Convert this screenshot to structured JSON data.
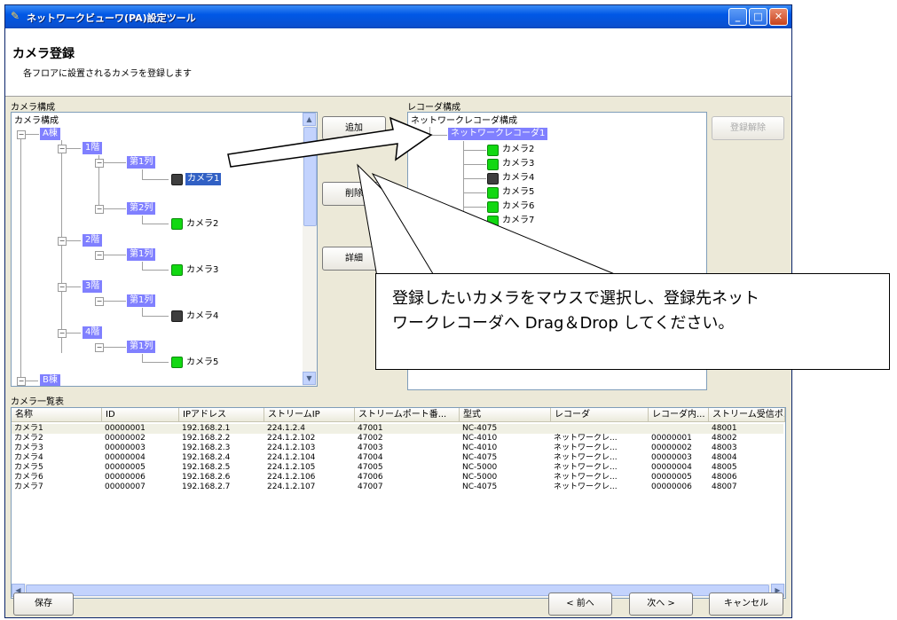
{
  "window": {
    "title": "ネットワークビューワ(PA)設定ツール"
  },
  "header": {
    "title": "カメラ登録",
    "subtitle": "各フロアに設置されるカメラを登録します"
  },
  "camera_tree": {
    "label": "カメラ構成",
    "root": "カメラ構成",
    "nodes": {
      "buildingA": "A棟",
      "floor1": "1階",
      "f1row1": "第1列",
      "cam1": "カメラ1",
      "f1row2": "第2列",
      "cam2": "カメラ2",
      "floor2": "2階",
      "f2row1": "第1列",
      "cam3": "カメラ3",
      "floor3": "3階",
      "f3row1": "第1列",
      "cam4": "カメラ4",
      "floor4": "4階",
      "f4row1": "第1列",
      "cam5": "カメラ5",
      "buildingB": "B棟"
    }
  },
  "recorder_tree": {
    "label": "レコーダ構成",
    "root": "ネットワークレコーダ構成",
    "recorder": "ネットワークレコーダ1",
    "cams": [
      "カメラ2",
      "カメラ3",
      "カメラ4",
      "カメラ5",
      "カメラ6",
      "カメラ7"
    ]
  },
  "buttons": {
    "add": "追加",
    "delete": "削除",
    "detail": "詳細",
    "unregister": "登録解除",
    "save": "保存",
    "prev": "< 前へ",
    "next": "次へ >",
    "cancel": "キャンセル"
  },
  "camera_list": {
    "label": "カメラ一覧表",
    "columns": [
      "名称",
      "ID",
      "IPアドレス",
      "ストリームIP",
      "ストリームポート番...",
      "型式",
      "レコーダ",
      "レコーダ内...",
      "ストリーム受信ポ..."
    ],
    "rows": [
      [
        "カメラ1",
        "00000001",
        "192.168.2.1",
        "224.1.2.4",
        "47001",
        "NC-4075",
        "",
        "",
        "48001"
      ],
      [
        "カメラ2",
        "00000002",
        "192.168.2.2",
        "224.1.2.102",
        "47002",
        "NC-4010",
        "ネットワークレ...",
        "00000001",
        "48002"
      ],
      [
        "カメラ3",
        "00000003",
        "192.168.2.3",
        "224.1.2.103",
        "47003",
        "NC-4010",
        "ネットワークレ...",
        "00000002",
        "48003"
      ],
      [
        "カメラ4",
        "00000004",
        "192.168.2.4",
        "224.1.2.104",
        "47004",
        "NC-4075",
        "ネットワークレ...",
        "00000003",
        "48004"
      ],
      [
        "カメラ5",
        "00000005",
        "192.168.2.5",
        "224.1.2.105",
        "47005",
        "NC-5000",
        "ネットワークレ...",
        "00000004",
        "48005"
      ],
      [
        "カメラ6",
        "00000006",
        "192.168.2.6",
        "224.1.2.106",
        "47006",
        "NC-5000",
        "ネットワークレ...",
        "00000005",
        "48006"
      ],
      [
        "カメラ7",
        "00000007",
        "192.168.2.7",
        "224.1.2.107",
        "47007",
        "NC-4075",
        "ネットワークレ...",
        "00000006",
        "48007"
      ]
    ]
  },
  "callout": {
    "line1": "登録したいカメラをマウスで選択し、登録先ネット",
    "line2": "ワークレコーダへ Drag＆Drop してください。"
  }
}
